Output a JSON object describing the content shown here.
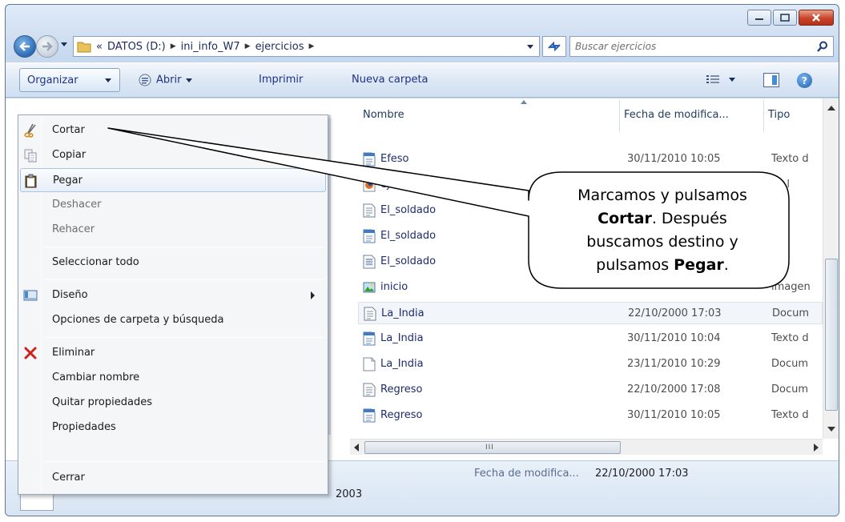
{
  "address": {
    "crumbs": [
      "DATOS (D:)",
      "ini_info_W7",
      "ejercicios"
    ],
    "overflow": "«"
  },
  "search": {
    "placeholder": "Buscar ejercicios"
  },
  "toolbar": {
    "organize_label": "Organizar",
    "open_label": "Abrir",
    "print_label": "Imprimir",
    "new_folder_label": "Nueva carpeta"
  },
  "columns": {
    "name": "Nombre",
    "date": "Fecha de modifica...",
    "type": "Tipo"
  },
  "files": [
    {
      "name": "Efeso",
      "date": "30/11/2010 10:05",
      "type": "Texto d",
      "icon": "doc-blue"
    },
    {
      "name": "ejer",
      "date": "",
      "type": "ox l",
      "icon": "firefox"
    },
    {
      "name": "El_soldado",
      "date": "",
      "type": "um",
      "icon": "doc"
    },
    {
      "name": "El_soldado",
      "date": "",
      "type": "o d",
      "icon": "doc-blue"
    },
    {
      "name": "El_soldado",
      "date": "",
      "type": "um",
      "icon": "doc-lines"
    },
    {
      "name": "inicio",
      "date": "",
      "type": "imagen",
      "icon": "image"
    },
    {
      "name": "La_India",
      "date": "22/10/2000 17:03",
      "type": "Docum",
      "icon": "doc"
    },
    {
      "name": "La_India",
      "date": "30/11/2010 10:04",
      "type": "Texto d",
      "icon": "doc-blue"
    },
    {
      "name": "La_India",
      "date": "23/11/2010 10:29",
      "type": "Docum",
      "icon": "blank"
    },
    {
      "name": "Regreso",
      "date": "22/10/2000 17:08",
      "type": "Docum",
      "icon": "doc"
    },
    {
      "name": "Regreso",
      "date": "30/11/2010 10:05",
      "type": "Texto d",
      "icon": "doc-blue"
    }
  ],
  "details": {
    "label": "Fecha de modifica...",
    "value": "22/10/2000 17:03",
    "extra": "2003"
  },
  "menu": {
    "cut": "Cortar",
    "copy": "Copiar",
    "paste": "Pegar",
    "undo": "Deshacer",
    "redo": "Rehacer",
    "select_all": "Seleccionar todo",
    "layout": "Diseño",
    "folder_options": "Opciones de carpeta y búsqueda",
    "delete": "Eliminar",
    "rename": "Cambiar nombre",
    "remove_props": "Quitar propiedades",
    "properties": "Propiedades",
    "close": "Cerrar"
  },
  "callout": {
    "line1": "Marcamos y pulsamos",
    "bold1": "Cortar",
    "text2": ". Después",
    "line3": "buscamos destino y",
    "text4": "pulsamos ",
    "bold2": "Pegar",
    "text5": "."
  }
}
